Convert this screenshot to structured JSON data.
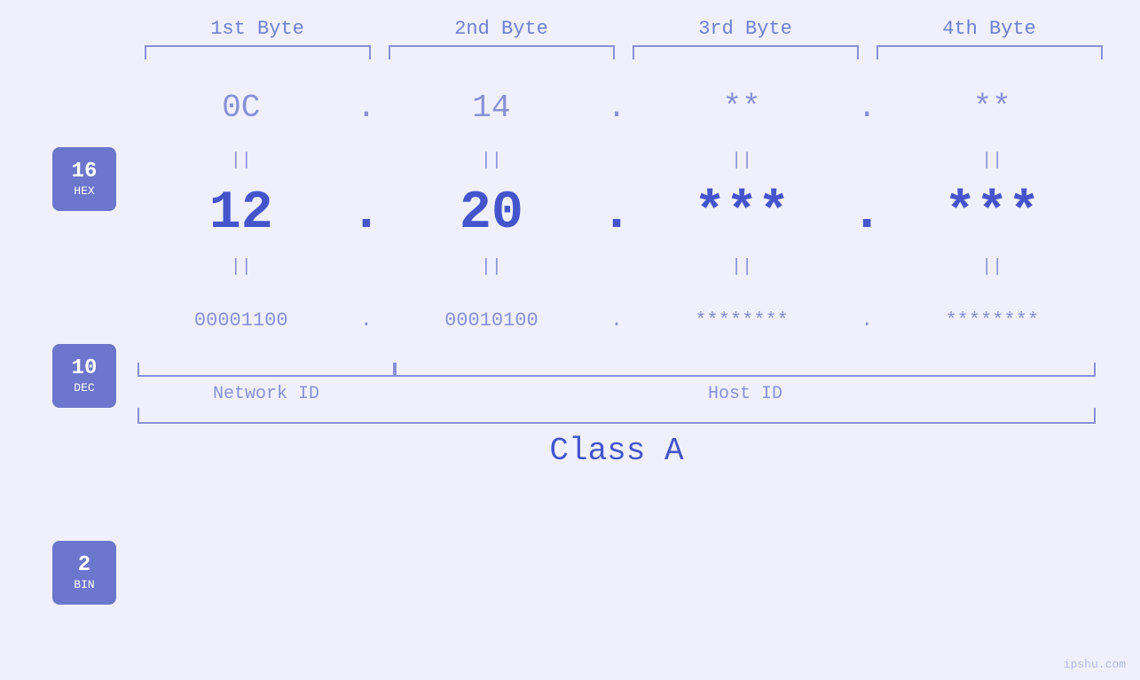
{
  "byteLabels": [
    "1st Byte",
    "2nd Byte",
    "3rd Byte",
    "4th Byte"
  ],
  "badges": [
    {
      "num": "16",
      "label": "HEX"
    },
    {
      "num": "10",
      "label": "DEC"
    },
    {
      "num": "2",
      "label": "BIN"
    }
  ],
  "hexRow": {
    "cells": [
      "0C",
      "14",
      "**",
      "**"
    ],
    "separator": "."
  },
  "decRow": {
    "cells": [
      "12",
      "20",
      "***",
      "***"
    ],
    "separator": "."
  },
  "binRow": {
    "cells": [
      "00001100",
      "00010100",
      "********",
      "********"
    ],
    "separator": "."
  },
  "equals": "||",
  "labels": {
    "networkID": "Network ID",
    "hostID": "Host ID",
    "classA": "Class A"
  },
  "watermark": "ipshu.com"
}
